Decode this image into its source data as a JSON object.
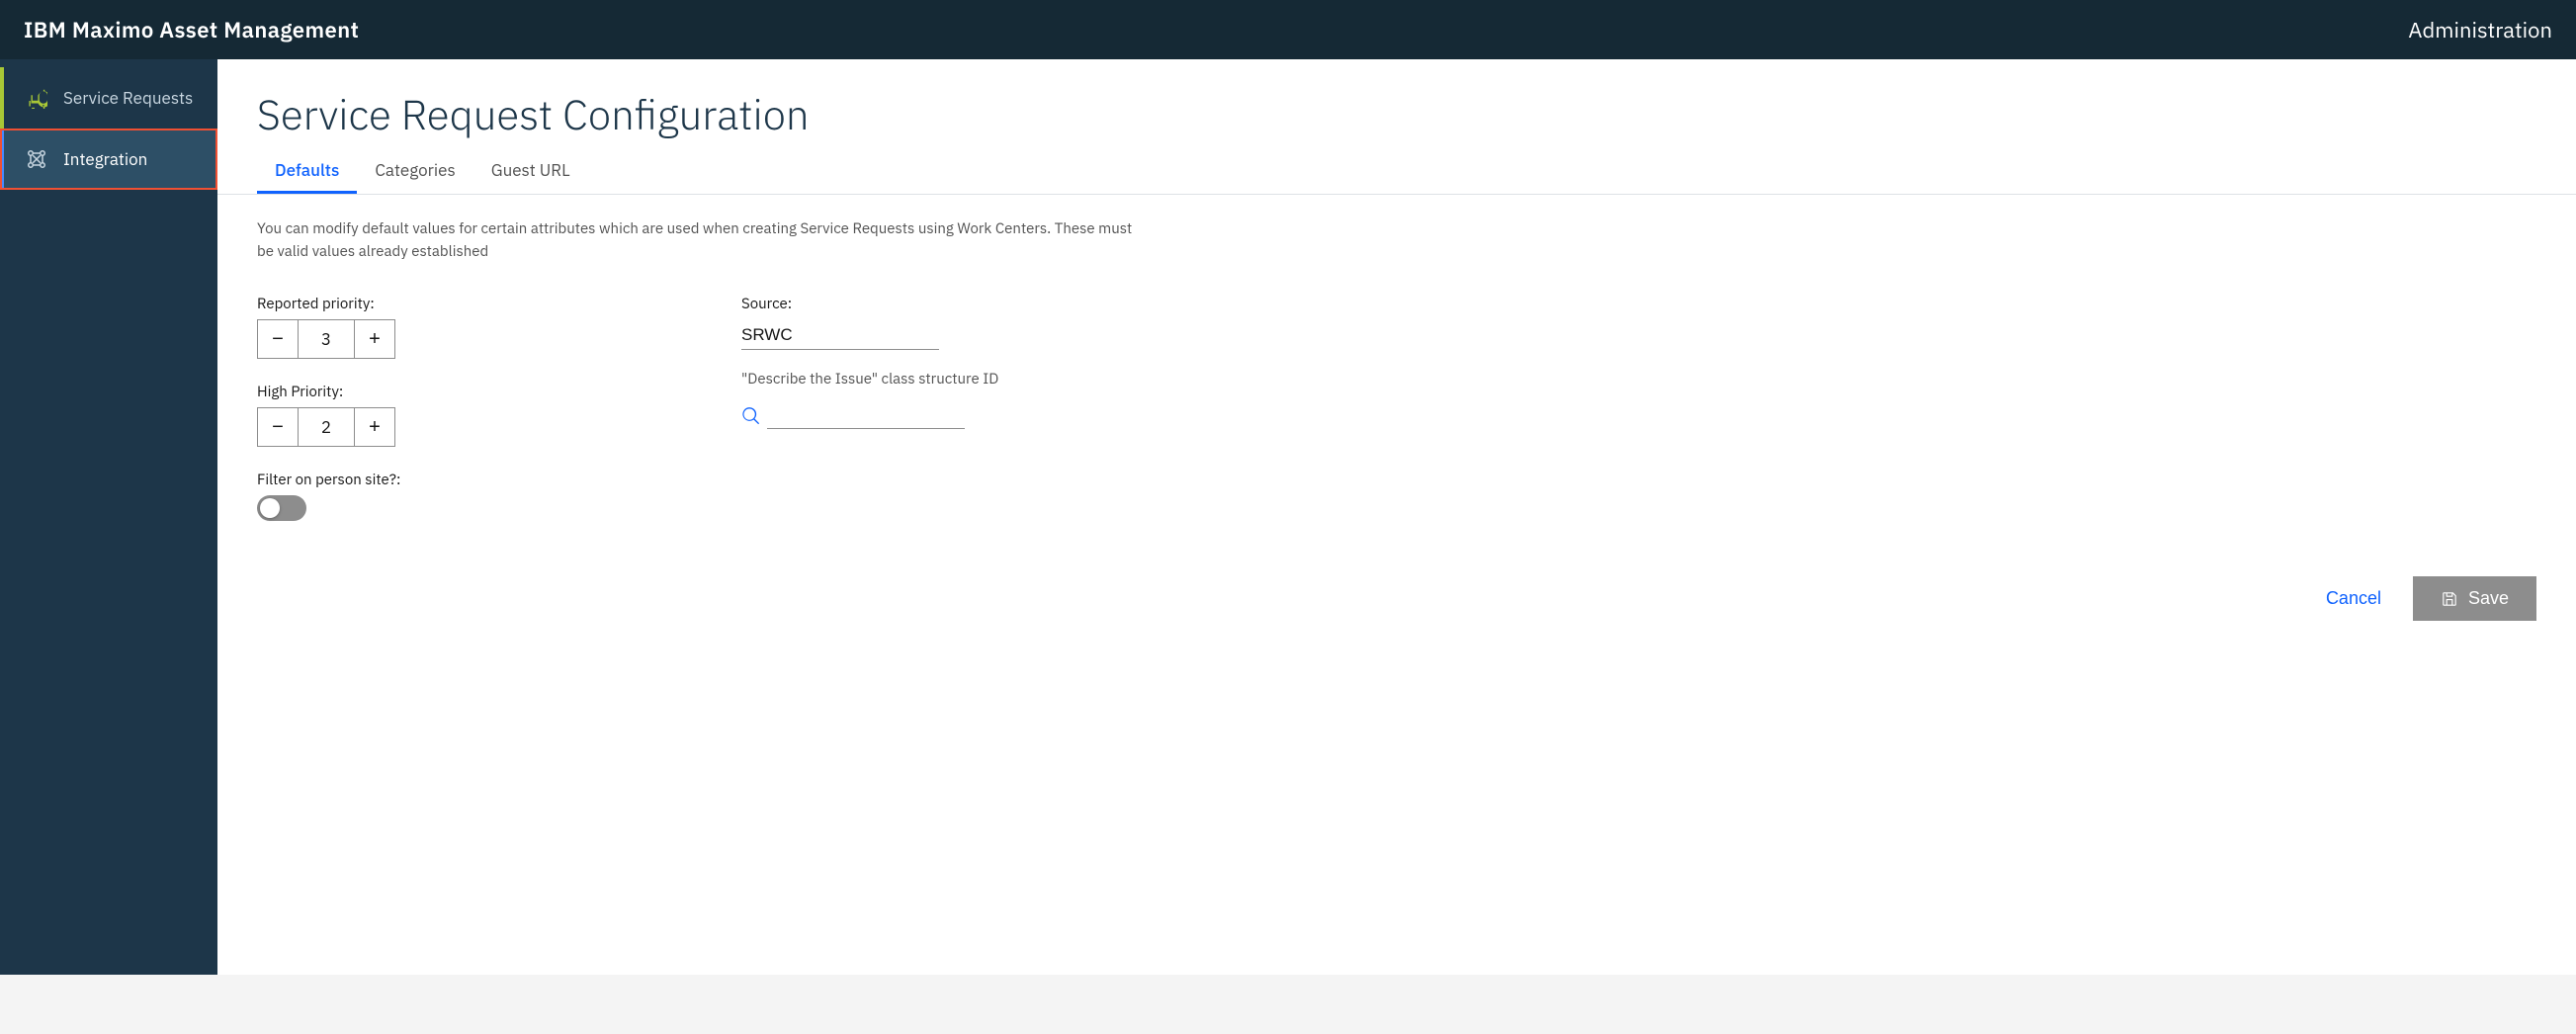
{
  "header": {
    "app_title": "IBM Maximo Asset Management",
    "section_title": "Administration"
  },
  "sidebar": {
    "items": [
      {
        "id": "service-requests",
        "label": "Service Requests",
        "icon": "megaphone-icon",
        "active": false
      },
      {
        "id": "integration",
        "label": "Integration",
        "icon": "integration-icon",
        "active": true
      }
    ]
  },
  "page": {
    "title": "Service Request Configuration",
    "tabs": [
      {
        "id": "defaults",
        "label": "Defaults",
        "active": true
      },
      {
        "id": "categories",
        "label": "Categories",
        "active": false
      },
      {
        "id": "guest-url",
        "label": "Guest URL",
        "active": false
      }
    ],
    "description": "You can modify default values for certain attributes which are used when creating Service Requests using Work Centers. These must be valid values already established",
    "form": {
      "reported_priority": {
        "label": "Reported priority:",
        "value": 3
      },
      "high_priority": {
        "label": "High Priority:",
        "value": 2
      },
      "filter_on_person_site": {
        "label": "Filter on person site?:",
        "enabled": false
      },
      "source": {
        "label": "Source:",
        "value": "SRWC"
      },
      "class_structure": {
        "label": "\"Describe the Issue\" class structure ID",
        "value": "",
        "placeholder": ""
      }
    },
    "actions": {
      "cancel_label": "Cancel",
      "save_label": "Save"
    }
  }
}
